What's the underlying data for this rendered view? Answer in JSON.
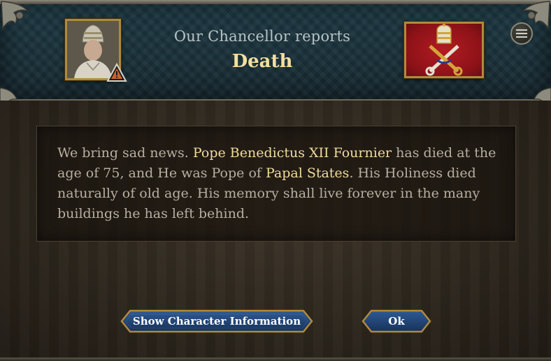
{
  "dialog": {
    "subtitle": "Our Chancellor reports",
    "title": "Death",
    "message": {
      "part1": "We bring sad news. ",
      "name": "Pope Benedictus XII Fournier",
      "part2": " has died at the age of 75, and He was Pope of ",
      "country": "Papal States",
      "part3": ". His Holiness died naturally of old age. His memory shall live forever in the many buildings he has left behind."
    }
  },
  "portrait": {
    "icon": "pope-portrait",
    "warning_icon": "warning-triangle-icon"
  },
  "flag": {
    "icon": "papal-keys-tiara-icon",
    "color": "#a3171d"
  },
  "menu": {
    "icon": "menu-icon"
  },
  "buttons": {
    "info_label": "Show Character Information",
    "ok_label": "Ok"
  },
  "colors": {
    "highlight": "#f0dc9c",
    "body_text": "#b6b0a2",
    "button_blue": "#1e3f6e",
    "frame_gold": "#b08a3c"
  }
}
